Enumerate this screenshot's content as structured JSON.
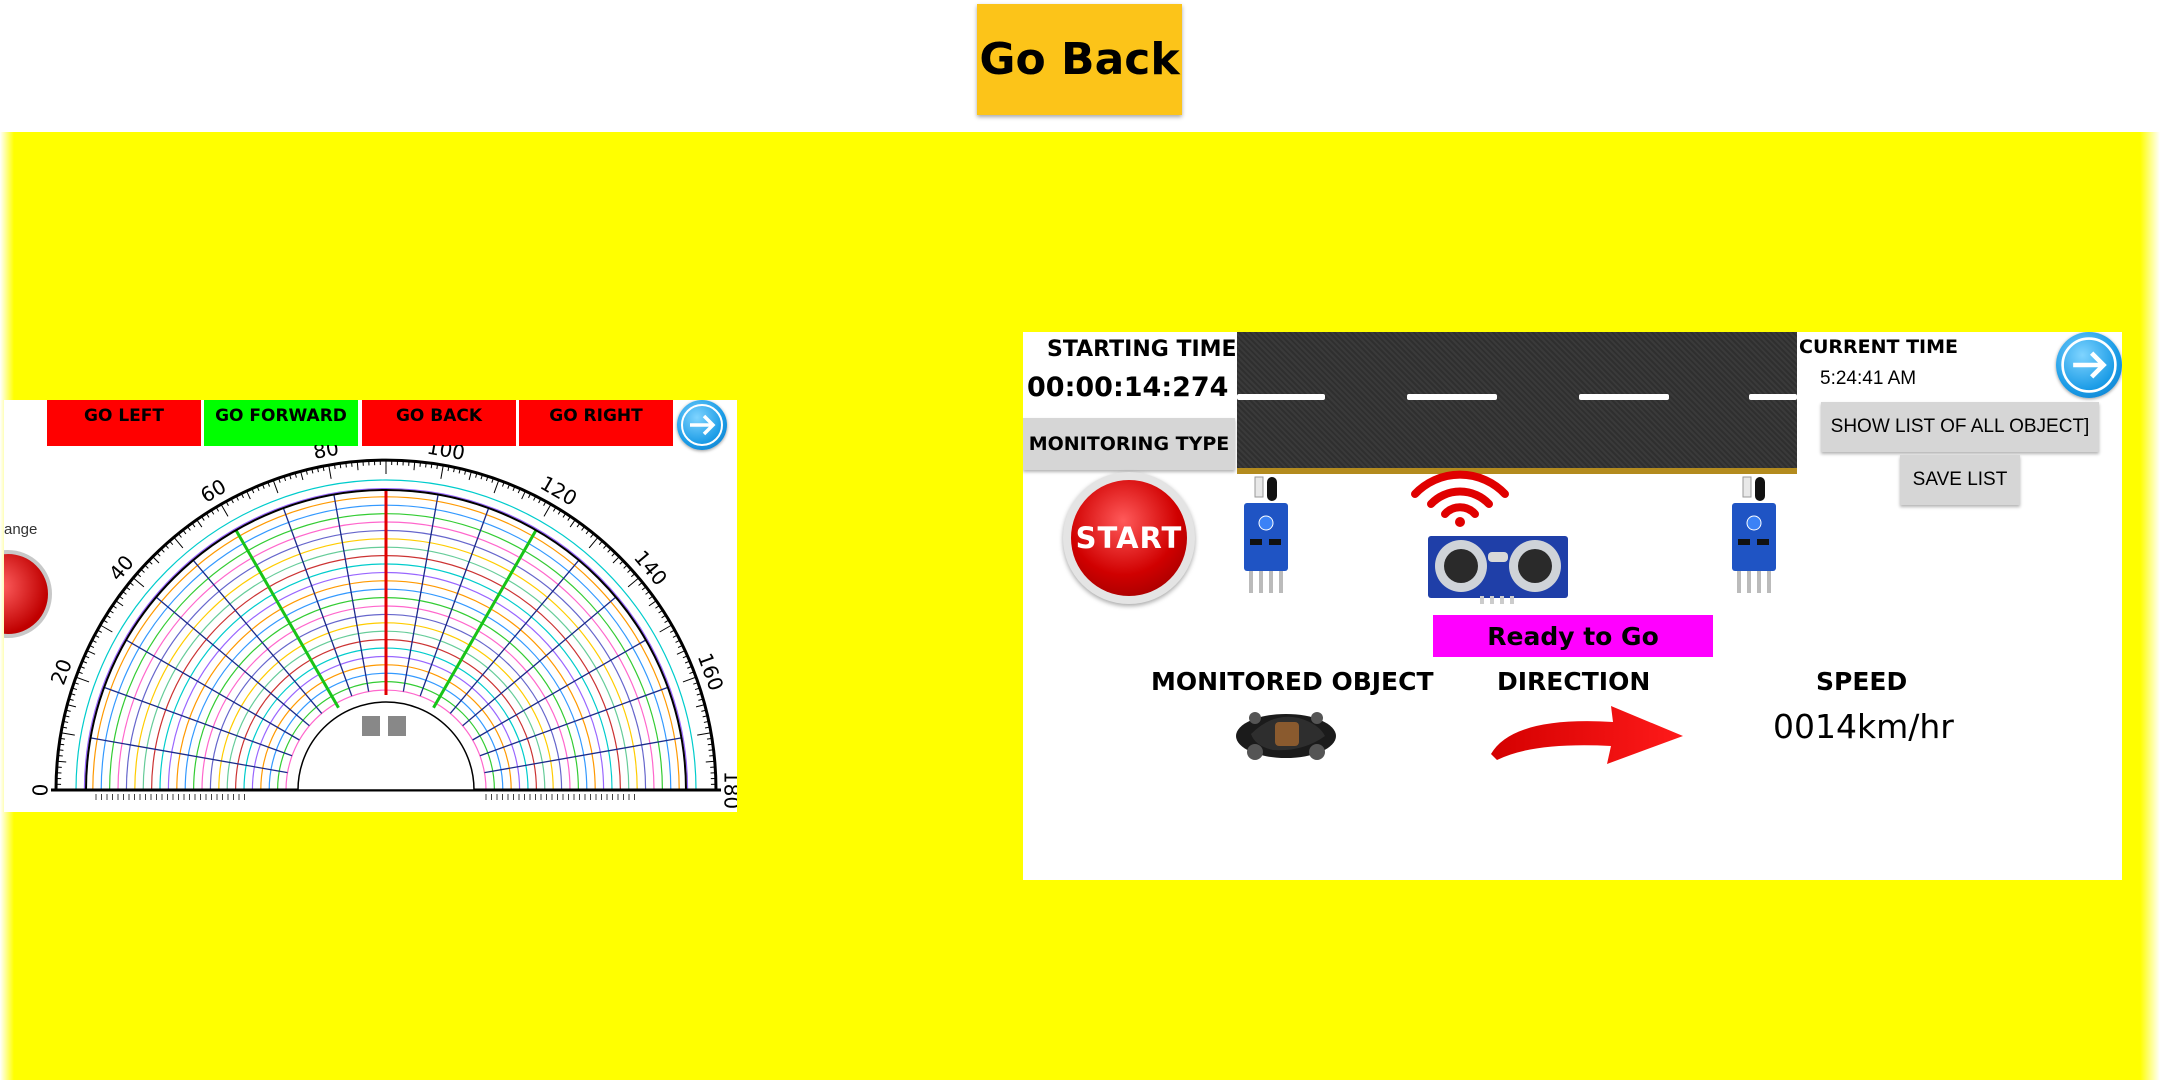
{
  "header": {
    "go_back_label": "Go Back"
  },
  "left_panel": {
    "controls": [
      {
        "label": "GO LEFT",
        "color": "#ff0000"
      },
      {
        "label": "GO FORWARD",
        "color": "#00ff00"
      },
      {
        "label": "GO BACK",
        "color": "#ff0000"
      },
      {
        "label": "GO RIGHT",
        "color": "#ff0000"
      }
    ],
    "partial_label": "ange",
    "protractor": {
      "degree_labels": [
        "0",
        "20",
        "40",
        "60",
        "80",
        "100",
        "120",
        "140",
        "160",
        "180"
      ],
      "highlighted_angles_deg": [
        60,
        90,
        120
      ]
    },
    "next_icon": "arrow-right-icon"
  },
  "right_panel": {
    "starting_time_label": "STARTING TIME",
    "starting_time_value": "00:00:14:274",
    "monitoring_type_label": "MONITORING TYPE",
    "start_label": "START",
    "current_time_label": "CURRENT TIME",
    "current_time_value": "5:24:41 AM",
    "show_list_label": "SHOW LIST OF ALL OBJECT]",
    "save_list_label": "SAVE LIST",
    "status_text": "Ready to Go",
    "monitored_object_label": "MONITORED OBJECT",
    "direction_label": "DIRECTION",
    "speed_label": "SPEED",
    "speed_value": "0014km/hr",
    "next_icon": "arrow-right-icon"
  },
  "colors": {
    "background_yellow": "#ffff00",
    "go_back_button": "#fcc419",
    "status_badge": "#ff00ff"
  }
}
